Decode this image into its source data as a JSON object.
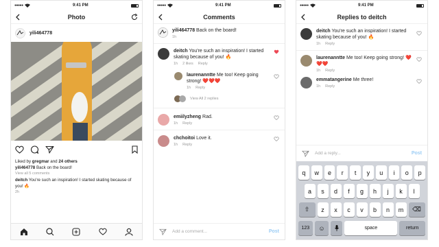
{
  "status": {
    "time": "9:41 PM"
  },
  "photo_screen": {
    "title": "Photo",
    "author": "yili464778",
    "liked_by_prefix": "Liked by",
    "liked_by_user": "gregmar",
    "liked_by_and": "and",
    "liked_by_others": "24 others",
    "caption_user": "yili464778",
    "caption_text": "Back on the board!",
    "view_all": "View all 5 comments",
    "comment_user": "deitch",
    "comment_text": "You're such an inspiration! I started skating because of you! 🔥",
    "age": "2h"
  },
  "comments_screen": {
    "title": "Comments",
    "caption": {
      "user": "yili464778",
      "text": "Back on the board!",
      "age": "1h"
    },
    "comments": [
      {
        "user": "deitch",
        "text": "You're such an inspiration! I started skating because of you! 🔥",
        "age": "1h",
        "likes": "2 likes",
        "reply": "Reply",
        "liked": true
      },
      {
        "user": "laurenanntte",
        "text": "Me too! Keep going strong! ❤️❤️❤️",
        "age": "1h",
        "reply": "Reply",
        "liked": false
      },
      {
        "user": "emiilyzheng",
        "text": "Rad.",
        "age": "1h",
        "reply": "Reply",
        "liked": false
      },
      {
        "user": "chchoitoi",
        "text": "Love it.",
        "age": "1h",
        "reply": "Reply",
        "liked": false
      }
    ],
    "view_replies": "View All 2 replies",
    "composer_placeholder": "Add a comment...",
    "post_label": "Post"
  },
  "replies_screen": {
    "title": "Replies to deitch",
    "items": [
      {
        "user": "deitch",
        "text": "You're such an inspiration! I started skating because of you! 🔥",
        "age": "1h",
        "reply": "Reply"
      },
      {
        "user": "laurenanntte",
        "text": "Me too! Keep going strong! ❤️❤️❤️",
        "age": "1h",
        "reply": "Reply"
      },
      {
        "user": "emmatangerine",
        "text": "Me three!",
        "age": "1h",
        "reply": "Reply"
      }
    ],
    "composer_placeholder": "Add a reply...",
    "post_label": "Post"
  },
  "keyboard": {
    "row1": [
      "q",
      "w",
      "e",
      "r",
      "t",
      "y",
      "u",
      "i",
      "o",
      "p"
    ],
    "row2": [
      "a",
      "s",
      "d",
      "f",
      "g",
      "h",
      "j",
      "k",
      "l"
    ],
    "row3": [
      "z",
      "x",
      "c",
      "v",
      "b",
      "n",
      "m"
    ],
    "numbers_key": "123",
    "space_key": "space",
    "return_key": "return"
  },
  "colors": {
    "heart_liked": "#ed4956",
    "link_blue": "#3897f0",
    "keyboard_bg": "#d1d4da"
  }
}
